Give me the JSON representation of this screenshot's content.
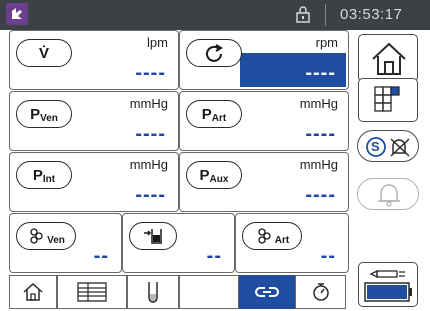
{
  "status_bar": {
    "time": "03:53:17",
    "icons": [
      "app-logo-icon",
      "lock-icon"
    ]
  },
  "panels": {
    "flow": {
      "symbol": "V̇",
      "unit": "lpm",
      "value": "----"
    },
    "rpm": {
      "symbol_icon": "rotation-arrow-icon",
      "unit": "rpm",
      "value": "----",
      "highlighted": true
    },
    "p_ven": {
      "symbol": "P",
      "sub": "Ven",
      "unit": "mmHg",
      "value": "----"
    },
    "p_art": {
      "symbol": "P",
      "sub": "Art",
      "unit": "mmHg",
      "value": "----"
    },
    "p_int": {
      "symbol": "P",
      "sub": "Int",
      "unit": "mmHg",
      "value": "----"
    },
    "p_aux": {
      "symbol": "P",
      "sub": "Aux",
      "unit": "mmHg",
      "value": "----"
    },
    "bubble_ven": {
      "symbol_icon": "bubble-sensor-icon",
      "sub": "Ven",
      "value": "--"
    },
    "level": {
      "symbol_icon": "level-sensor-icon",
      "value": "--"
    },
    "bubble_art": {
      "symbol_icon": "bubble-sensor-icon",
      "sub": "Art",
      "value": "--"
    }
  },
  "right_column": {
    "buttons": [
      "home-icon",
      "grid-layout-icon",
      "alarm-silence-icon",
      "bell-icon",
      "battery-icon"
    ],
    "alarm_silence_letter": "S"
  },
  "bottom_bar": {
    "items": [
      "home-icon",
      "list-view-icon",
      "test-tube-icon",
      "link-icon",
      "timer-icon"
    ],
    "active_index": 3
  },
  "colors": {
    "accent_blue": "#1f4ea1",
    "value_blue": "#1b46a2",
    "top_bar": "#3c4146"
  }
}
